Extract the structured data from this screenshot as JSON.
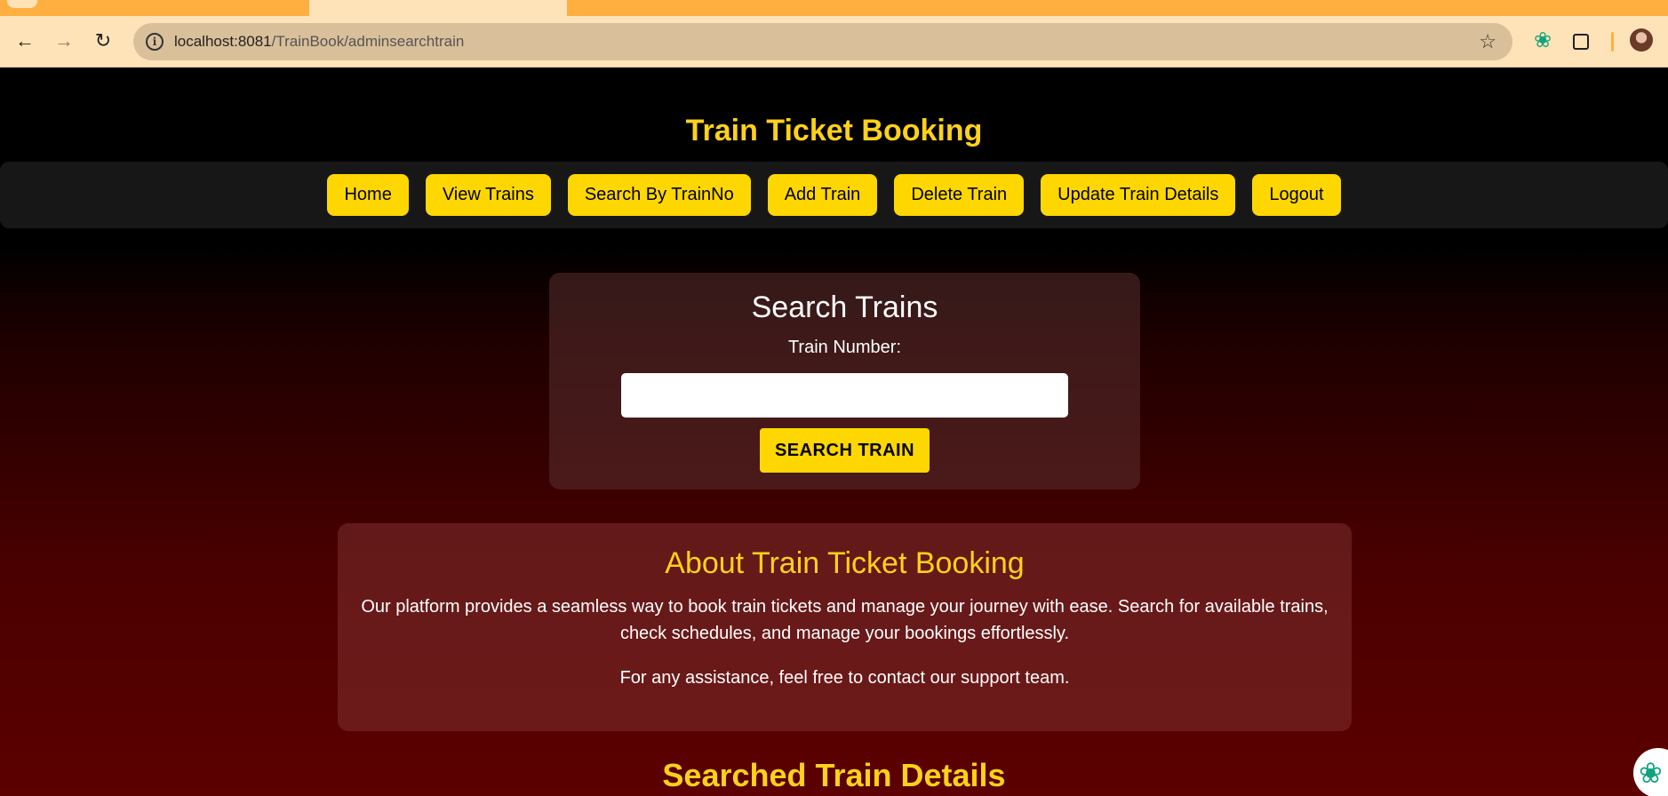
{
  "browser": {
    "url_host": "localhost:8081",
    "url_path": "/TrainBook/adminsearchtrain"
  },
  "header": {
    "title": "Train Ticket Booking"
  },
  "nav": {
    "items": [
      {
        "label": "Home"
      },
      {
        "label": "View Trains"
      },
      {
        "label": "Search By TrainNo"
      },
      {
        "label": "Add Train"
      },
      {
        "label": "Delete Train"
      },
      {
        "label": "Update Train Details"
      },
      {
        "label": "Logout"
      }
    ]
  },
  "search": {
    "title": "Search Trains",
    "label": "Train Number:",
    "value": "",
    "button": "SEARCH TRAIN"
  },
  "about": {
    "title": "About Train Ticket Booking",
    "paragraph1": "Our platform provides a seamless way to book train tickets and manage your journey with ease. Search for available trains, check schedules, and manage your bookings effortlessly.",
    "paragraph2": "For any assistance, feel free to contact our support team."
  },
  "results": {
    "title": "Searched Train Details"
  },
  "colors": {
    "accent": "#ffd700",
    "title": "#ffd11a",
    "chrome": "#ffe3b8"
  }
}
